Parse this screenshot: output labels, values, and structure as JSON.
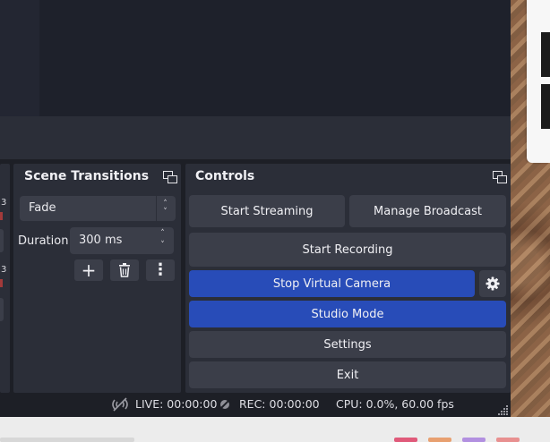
{
  "scene_transitions": {
    "title": "Scene Transitions",
    "transition_value": "Fade",
    "duration_label": "Duration",
    "duration_value": "300 ms",
    "add_label": "+",
    "more_label": "⋮"
  },
  "controls": {
    "title": "Controls",
    "start_streaming": "Start Streaming",
    "manage_broadcast": "Manage Broadcast",
    "start_recording": "Start Recording",
    "stop_virtual_camera": "Stop Virtual Camera",
    "studio_mode": "Studio Mode",
    "settings": "Settings",
    "exit": "Exit"
  },
  "status": {
    "live": "LIVE: 00:00:00",
    "rec": "REC: 00:00:00",
    "cpu": "CPU: 0.0%, 60.00 fps"
  },
  "left_fragment": {
    "digit_top": "3",
    "digit_bottom": "3"
  },
  "colors": {
    "active_button": "#284cb8",
    "dock_background": "#2b2e38",
    "button_background": "#3b3e49"
  },
  "icons": {
    "float": "dock-float-icon",
    "gear": "gear-icon",
    "trash": "trash-icon",
    "signal_off": "signal-off-icon",
    "rec_off": "rec-off-icon"
  }
}
